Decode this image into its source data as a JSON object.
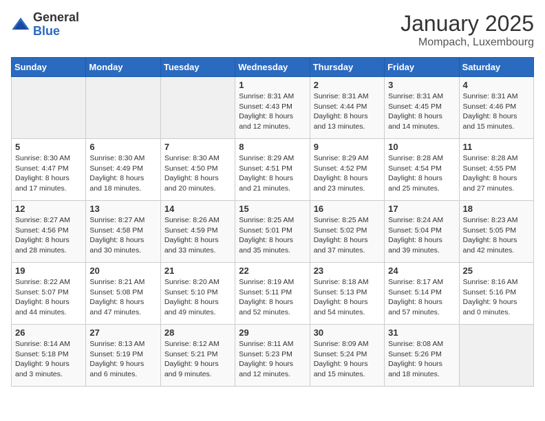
{
  "logo": {
    "general": "General",
    "blue": "Blue"
  },
  "title": {
    "month_year": "January 2025",
    "location": "Mompach, Luxembourg"
  },
  "days_of_week": [
    "Sunday",
    "Monday",
    "Tuesday",
    "Wednesday",
    "Thursday",
    "Friday",
    "Saturday"
  ],
  "weeks": [
    [
      {
        "day": "",
        "info": ""
      },
      {
        "day": "",
        "info": ""
      },
      {
        "day": "",
        "info": ""
      },
      {
        "day": "1",
        "info": "Sunrise: 8:31 AM\nSunset: 4:43 PM\nDaylight: 8 hours\nand 12 minutes."
      },
      {
        "day": "2",
        "info": "Sunrise: 8:31 AM\nSunset: 4:44 PM\nDaylight: 8 hours\nand 13 minutes."
      },
      {
        "day": "3",
        "info": "Sunrise: 8:31 AM\nSunset: 4:45 PM\nDaylight: 8 hours\nand 14 minutes."
      },
      {
        "day": "4",
        "info": "Sunrise: 8:31 AM\nSunset: 4:46 PM\nDaylight: 8 hours\nand 15 minutes."
      }
    ],
    [
      {
        "day": "5",
        "info": "Sunrise: 8:30 AM\nSunset: 4:47 PM\nDaylight: 8 hours\nand 17 minutes."
      },
      {
        "day": "6",
        "info": "Sunrise: 8:30 AM\nSunset: 4:49 PM\nDaylight: 8 hours\nand 18 minutes."
      },
      {
        "day": "7",
        "info": "Sunrise: 8:30 AM\nSunset: 4:50 PM\nDaylight: 8 hours\nand 20 minutes."
      },
      {
        "day": "8",
        "info": "Sunrise: 8:29 AM\nSunset: 4:51 PM\nDaylight: 8 hours\nand 21 minutes."
      },
      {
        "day": "9",
        "info": "Sunrise: 8:29 AM\nSunset: 4:52 PM\nDaylight: 8 hours\nand 23 minutes."
      },
      {
        "day": "10",
        "info": "Sunrise: 8:28 AM\nSunset: 4:54 PM\nDaylight: 8 hours\nand 25 minutes."
      },
      {
        "day": "11",
        "info": "Sunrise: 8:28 AM\nSunset: 4:55 PM\nDaylight: 8 hours\nand 27 minutes."
      }
    ],
    [
      {
        "day": "12",
        "info": "Sunrise: 8:27 AM\nSunset: 4:56 PM\nDaylight: 8 hours\nand 28 minutes."
      },
      {
        "day": "13",
        "info": "Sunrise: 8:27 AM\nSunset: 4:58 PM\nDaylight: 8 hours\nand 30 minutes."
      },
      {
        "day": "14",
        "info": "Sunrise: 8:26 AM\nSunset: 4:59 PM\nDaylight: 8 hours\nand 33 minutes."
      },
      {
        "day": "15",
        "info": "Sunrise: 8:25 AM\nSunset: 5:01 PM\nDaylight: 8 hours\nand 35 minutes."
      },
      {
        "day": "16",
        "info": "Sunrise: 8:25 AM\nSunset: 5:02 PM\nDaylight: 8 hours\nand 37 minutes."
      },
      {
        "day": "17",
        "info": "Sunrise: 8:24 AM\nSunset: 5:04 PM\nDaylight: 8 hours\nand 39 minutes."
      },
      {
        "day": "18",
        "info": "Sunrise: 8:23 AM\nSunset: 5:05 PM\nDaylight: 8 hours\nand 42 minutes."
      }
    ],
    [
      {
        "day": "19",
        "info": "Sunrise: 8:22 AM\nSunset: 5:07 PM\nDaylight: 8 hours\nand 44 minutes."
      },
      {
        "day": "20",
        "info": "Sunrise: 8:21 AM\nSunset: 5:08 PM\nDaylight: 8 hours\nand 47 minutes."
      },
      {
        "day": "21",
        "info": "Sunrise: 8:20 AM\nSunset: 5:10 PM\nDaylight: 8 hours\nand 49 minutes."
      },
      {
        "day": "22",
        "info": "Sunrise: 8:19 AM\nSunset: 5:11 PM\nDaylight: 8 hours\nand 52 minutes."
      },
      {
        "day": "23",
        "info": "Sunrise: 8:18 AM\nSunset: 5:13 PM\nDaylight: 8 hours\nand 54 minutes."
      },
      {
        "day": "24",
        "info": "Sunrise: 8:17 AM\nSunset: 5:14 PM\nDaylight: 8 hours\nand 57 minutes."
      },
      {
        "day": "25",
        "info": "Sunrise: 8:16 AM\nSunset: 5:16 PM\nDaylight: 9 hours\nand 0 minutes."
      }
    ],
    [
      {
        "day": "26",
        "info": "Sunrise: 8:14 AM\nSunset: 5:18 PM\nDaylight: 9 hours\nand 3 minutes."
      },
      {
        "day": "27",
        "info": "Sunrise: 8:13 AM\nSunset: 5:19 PM\nDaylight: 9 hours\nand 6 minutes."
      },
      {
        "day": "28",
        "info": "Sunrise: 8:12 AM\nSunset: 5:21 PM\nDaylight: 9 hours\nand 9 minutes."
      },
      {
        "day": "29",
        "info": "Sunrise: 8:11 AM\nSunset: 5:23 PM\nDaylight: 9 hours\nand 12 minutes."
      },
      {
        "day": "30",
        "info": "Sunrise: 8:09 AM\nSunset: 5:24 PM\nDaylight: 9 hours\nand 15 minutes."
      },
      {
        "day": "31",
        "info": "Sunrise: 8:08 AM\nSunset: 5:26 PM\nDaylight: 9 hours\nand 18 minutes."
      },
      {
        "day": "",
        "info": ""
      }
    ]
  ]
}
